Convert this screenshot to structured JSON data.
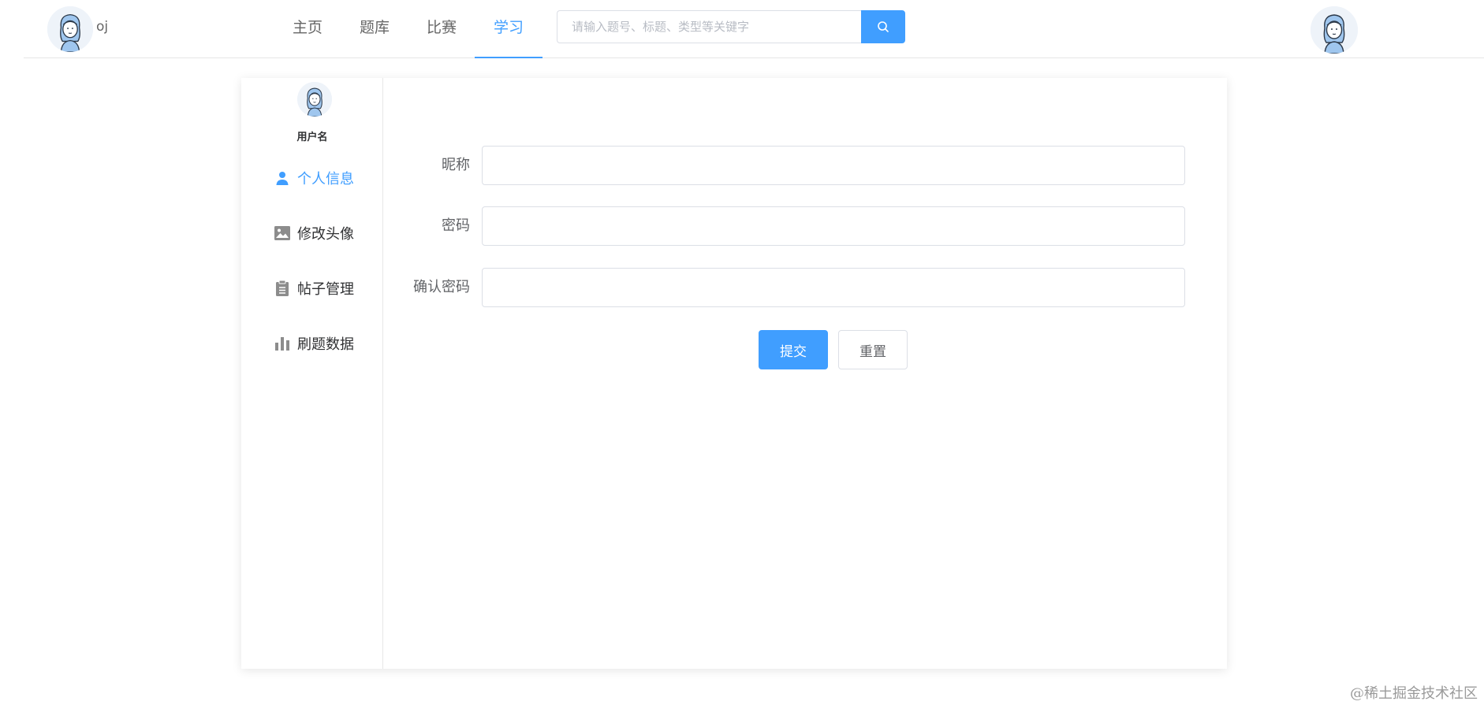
{
  "header": {
    "brand_name": "oj",
    "nav": [
      {
        "label": "主页"
      },
      {
        "label": "题库"
      },
      {
        "label": "比赛"
      },
      {
        "label": "学习"
      }
    ],
    "active_nav": "学习",
    "search": {
      "placeholder": "请输入题号、标题、类型等关键字",
      "value": ""
    },
    "accent_color": "#409eff"
  },
  "sidebar": {
    "username": "用户名",
    "items": [
      {
        "label": "个人信息",
        "icon": "user-icon",
        "active": true
      },
      {
        "label": "修改头像",
        "icon": "image-icon",
        "active": false
      },
      {
        "label": "帖子管理",
        "icon": "clipboard-icon",
        "active": false
      },
      {
        "label": "刷题数据",
        "icon": "bar-chart-icon",
        "active": false
      }
    ]
  },
  "form": {
    "fields": [
      {
        "label": "昵称",
        "value": ""
      },
      {
        "label": "密码",
        "value": ""
      },
      {
        "label": "确认密码",
        "value": ""
      }
    ],
    "submit_label": "提交",
    "reset_label": "重置"
  },
  "watermark": "@稀土掘金技术社区"
}
